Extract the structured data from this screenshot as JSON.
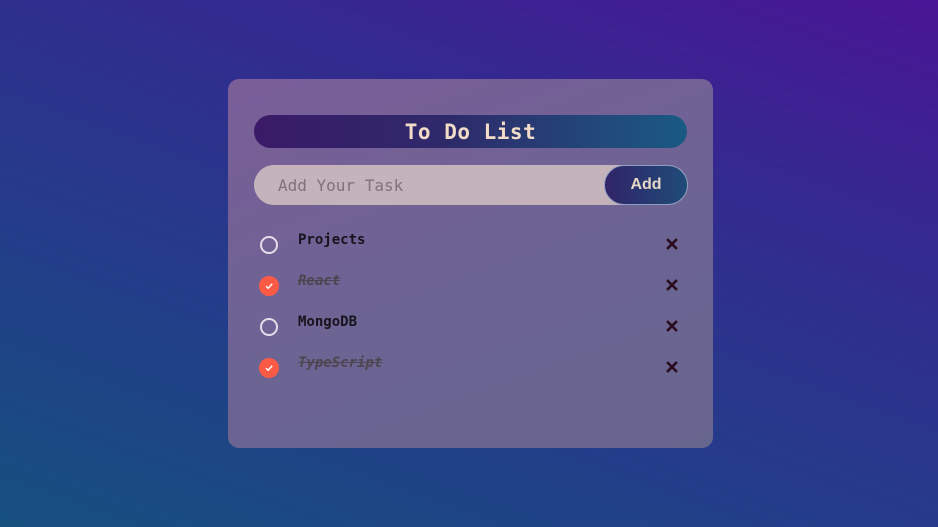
{
  "app": {
    "title": "To Do List"
  },
  "input": {
    "placeholder": "Add Your Task",
    "value": "",
    "add_label": "Add"
  },
  "tasks": [
    {
      "label": "Projects",
      "done": false
    },
    {
      "label": "React",
      "done": true
    },
    {
      "label": "MongoDB",
      "done": false
    },
    {
      "label": "TypeScript",
      "done": true
    }
  ],
  "icons": {
    "unchecked": "circle-icon",
    "checked": "checkmark-icon",
    "delete": "close-icon"
  },
  "colors": {
    "checked": "#ff5a45",
    "delete": "#2a0c1e",
    "title_text": "#f2dcc8"
  }
}
